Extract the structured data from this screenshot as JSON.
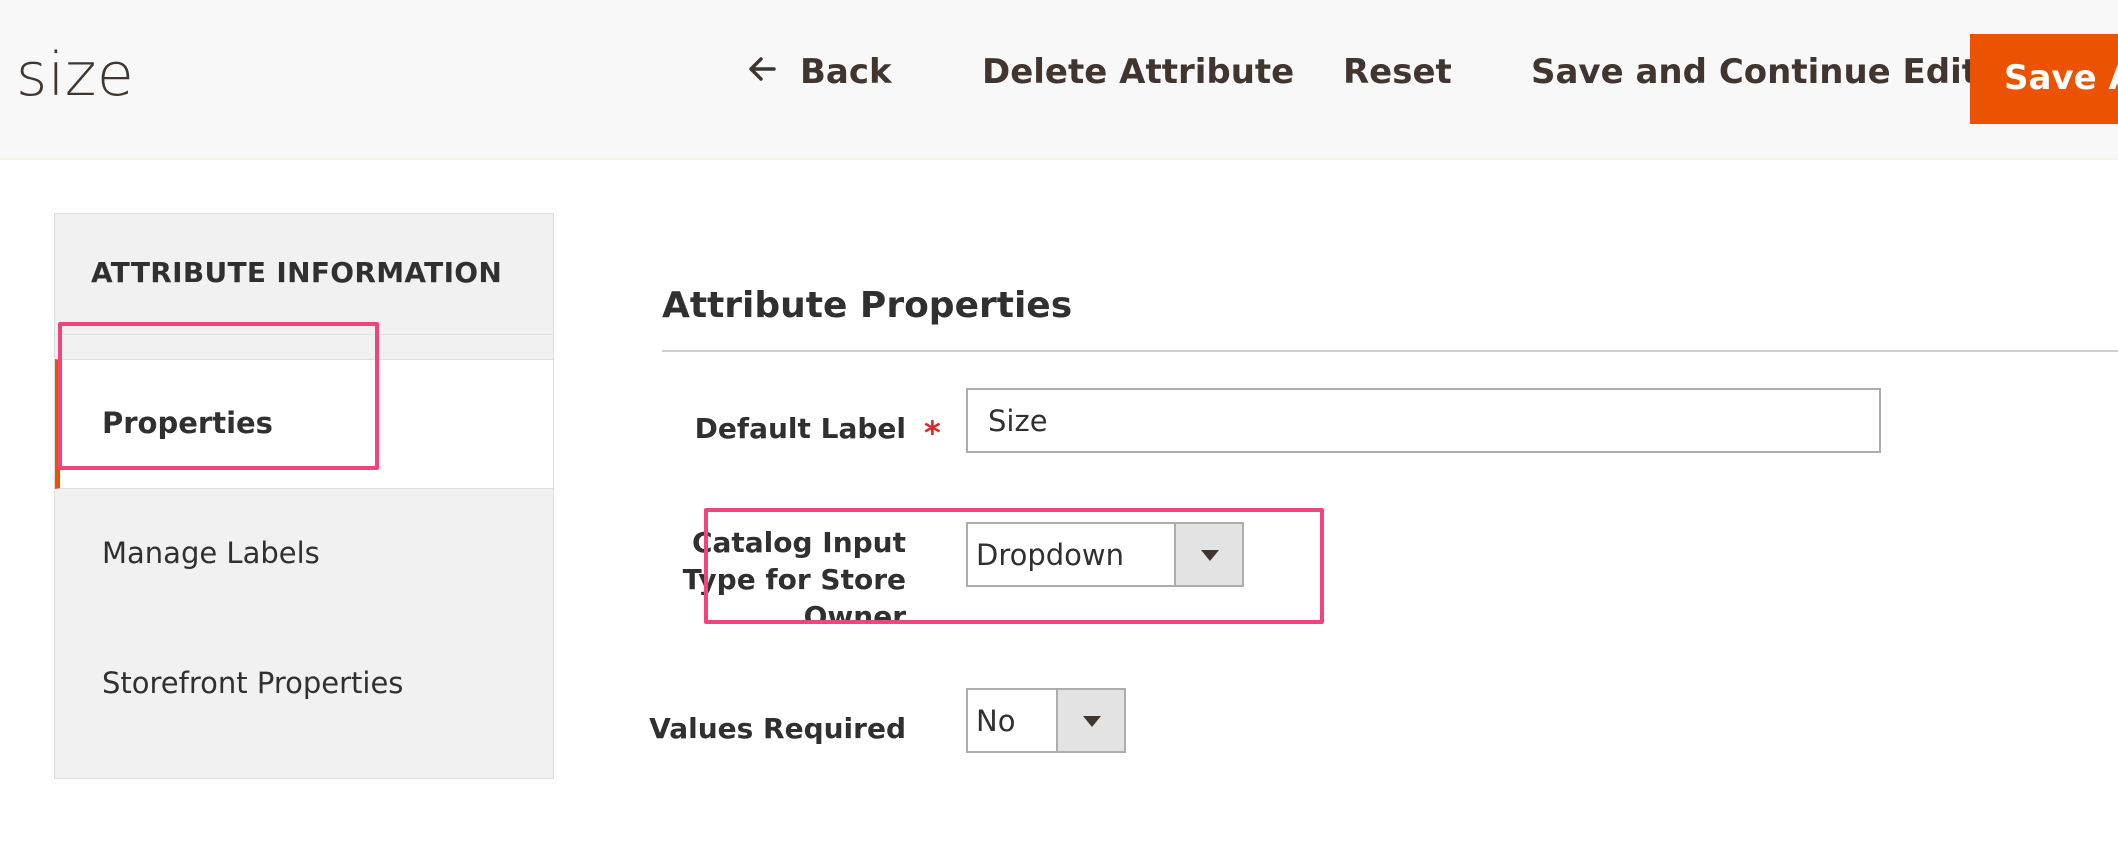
{
  "header": {
    "title": "size",
    "back_label": "Back",
    "delete_label": "Delete Attribute",
    "reset_label": "Reset",
    "save_continue_label": "Save and Continue Edit",
    "save_label": "Save Attribute"
  },
  "sidebar": {
    "title": "ATTRIBUTE INFORMATION",
    "tabs": [
      {
        "label": "Properties"
      },
      {
        "label": "Manage Labels"
      },
      {
        "label": "Storefront Properties"
      }
    ]
  },
  "main": {
    "section_title": "Attribute Properties",
    "fields": {
      "default_label": {
        "label": "Default Label",
        "required_mark": "*",
        "value": "Size"
      },
      "catalog_input_type": {
        "label": "Catalog Input Type for Store Owner",
        "value": "Dropdown"
      },
      "values_required": {
        "label": "Values Required",
        "value": "No"
      }
    }
  },
  "colors": {
    "accent": "#eb5202",
    "highlight": "#f0457c",
    "required": "#e22626"
  },
  "icons": {
    "back": "arrow-left-icon",
    "dropdown": "chevron-down-icon"
  }
}
